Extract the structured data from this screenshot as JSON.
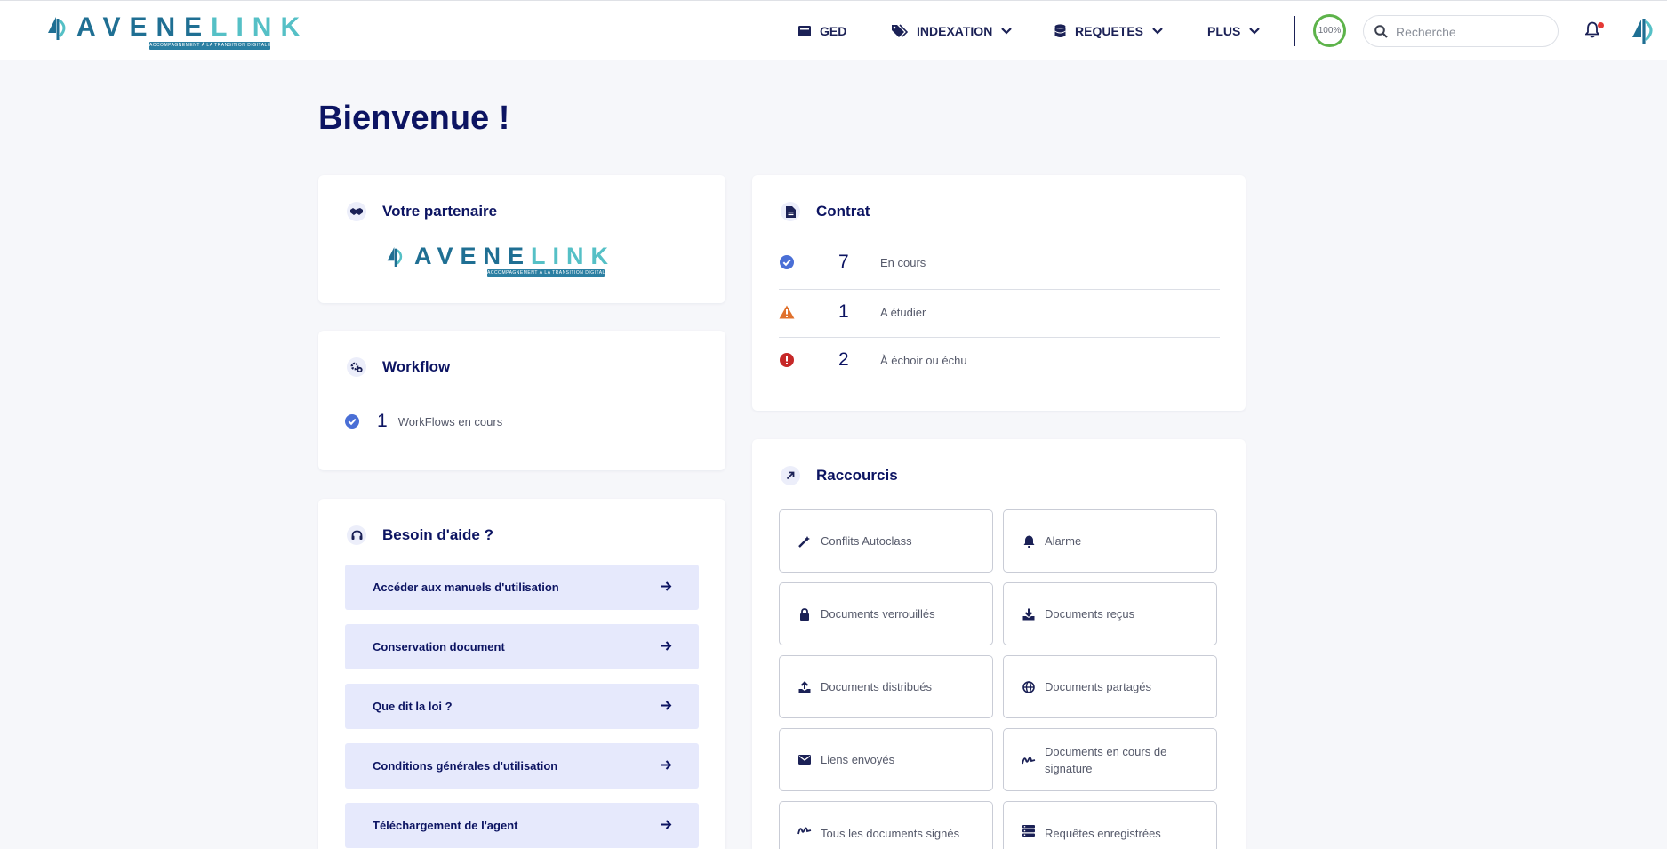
{
  "header": {
    "logo": {
      "text_a": "AVENE",
      "text_b": "LINK",
      "tagline": "ACCOMPAGNEMENT À LA TRANSITION DIGITALE"
    },
    "nav": {
      "ged": "GED",
      "indexation": "INDEXATION",
      "requetes": "REQUETES",
      "plus": "PLUS"
    },
    "progress": "100%",
    "search_placeholder": "Recherche"
  },
  "page_title": "Bienvenue !",
  "partner": {
    "title": "Votre partenaire",
    "logo": {
      "text_a": "AVENE",
      "text_b": "LINK",
      "tagline": "ACCOMPAGNEMENT À LA TRANSITION DIGITALE"
    }
  },
  "workflow": {
    "title": "Workflow",
    "count": "1",
    "label": "WorkFlows en cours"
  },
  "help": {
    "title": "Besoin d'aide ?",
    "items": [
      "Accéder aux manuels d'utilisation",
      "Conservation document",
      "Que dit la loi ?",
      "Conditions générales d'utilisation",
      "Téléchargement de l'agent"
    ]
  },
  "contract": {
    "title": "Contrat",
    "rows": [
      {
        "count": "7",
        "label": "En cours",
        "status": "check",
        "color": "#4a6fd6"
      },
      {
        "count": "1",
        "label": "A étudier",
        "status": "warning",
        "color": "#e0712d"
      },
      {
        "count": "2",
        "label": "À échoir ou échu",
        "status": "error",
        "color": "#c62828"
      }
    ]
  },
  "shortcuts": {
    "title": "Raccourcis",
    "items": [
      {
        "label": "Conflits Autoclass",
        "icon": "magic-wand-icon"
      },
      {
        "label": "Alarme",
        "icon": "bell-icon"
      },
      {
        "label": "Documents verrouillés",
        "icon": "lock-icon"
      },
      {
        "label": "Documents reçus",
        "icon": "download-icon"
      },
      {
        "label": "Documents distribués",
        "icon": "upload-icon"
      },
      {
        "label": "Documents partagés",
        "icon": "globe-icon"
      },
      {
        "label": "Liens envoyés",
        "icon": "envelope-icon"
      },
      {
        "label": "Documents en cours de signature",
        "icon": "signature-icon"
      },
      {
        "label": "Tous les documents signés",
        "icon": "signature-icon"
      },
      {
        "label": "Requêtes enregistrées",
        "icon": "saved-query-icon"
      }
    ]
  },
  "colors": {
    "primary": "#0c1462",
    "logo_dark": "#1f6f93",
    "logo_light": "#55c0c6",
    "help_button_bg": "#e6e9fc",
    "progress_ring": "#5db34a"
  }
}
